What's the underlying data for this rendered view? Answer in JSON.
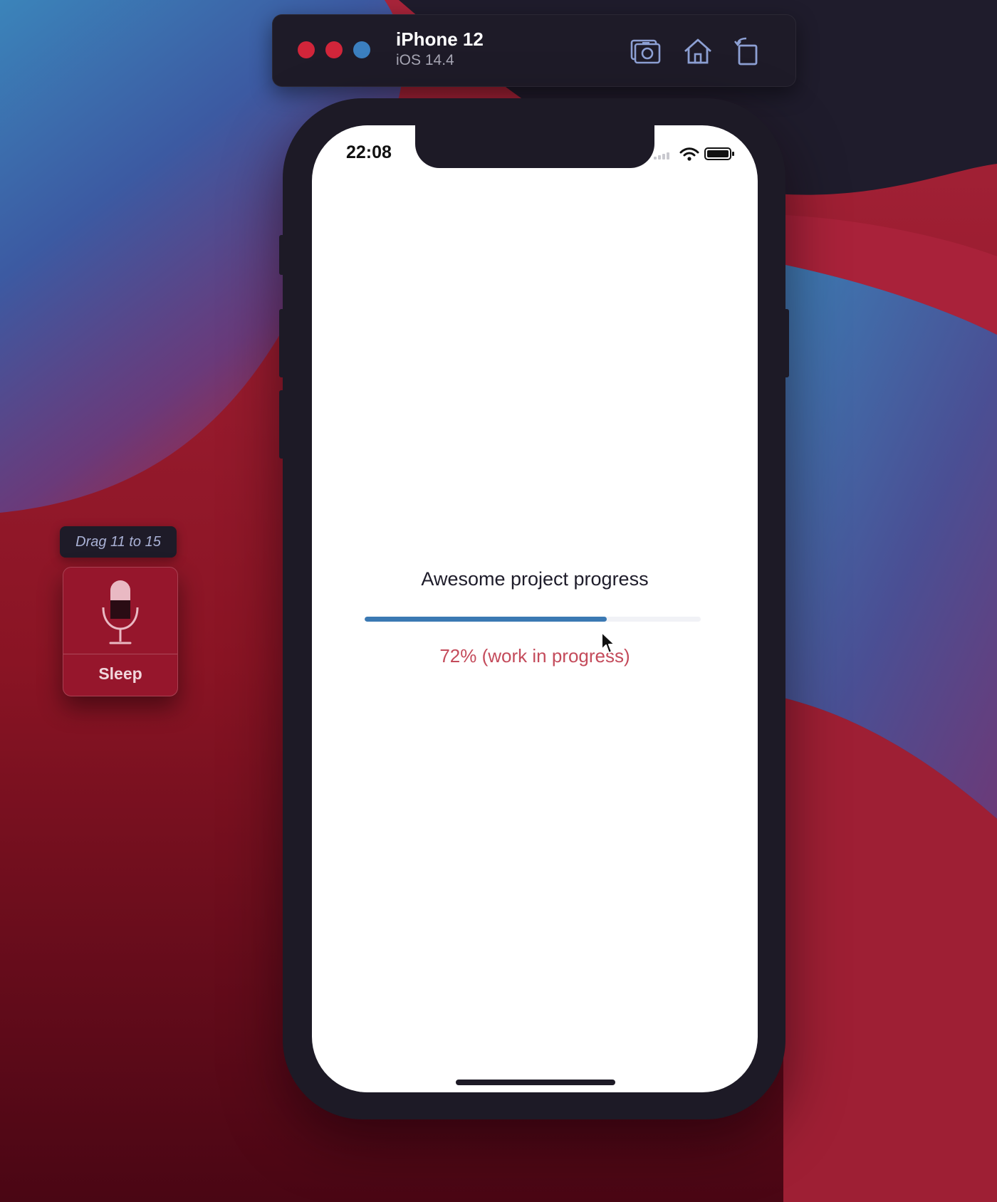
{
  "simulator": {
    "device_name": "iPhone 12",
    "os_version": "iOS 14.4",
    "toolbar": [
      {
        "icon": "screenshot-camera-icon"
      },
      {
        "icon": "home-icon"
      },
      {
        "icon": "rotate-icon"
      }
    ],
    "traffic_lights": {
      "close": "#d1253a",
      "minimize": "#d1253a",
      "zoom": "#3b7fbf"
    }
  },
  "status_bar": {
    "time": "22:08",
    "icons": [
      "cellular-icon",
      "wifi-icon",
      "battery-icon"
    ]
  },
  "app": {
    "title": "Awesome project progress",
    "progress": 0.72,
    "progress_text": "72% (work in progress)",
    "colors": {
      "progress_fill": "#3b79b3",
      "progress_text": "#c44b5b"
    }
  },
  "voice_control": {
    "drag_hint": "Drag 11 to 15",
    "status_label": "Sleep",
    "icon": "microphone-icon"
  }
}
